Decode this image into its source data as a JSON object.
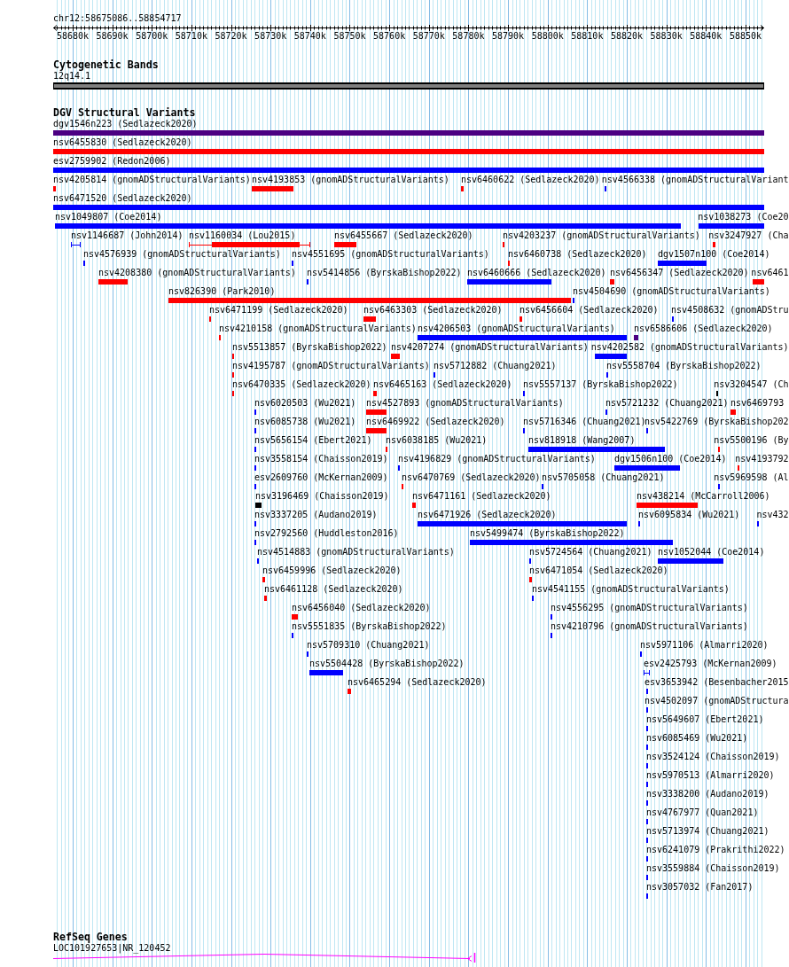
{
  "ruler": {
    "locus": "chr12:58675086..58854717",
    "ticks": [
      "58680k",
      "58690k",
      "58700k",
      "58710k",
      "58720k",
      "58730k",
      "58740k",
      "58750k",
      "58760k",
      "58770k",
      "58780k",
      "58790k",
      "58800k",
      "58810k",
      "58820k",
      "58830k",
      "58840k",
      "58850k"
    ]
  },
  "tracks": [
    {
      "kind": "bands",
      "title": "Cytogenetic Bands",
      "features": [
        {
          "label": "12q14.1"
        }
      ]
    },
    {
      "kind": "variants",
      "title": "DGV Structural Variants",
      "rows": [
        {
          "features": [
            {
              "label": "dgv1546n223 (Sedlazeck2020)",
              "color": "#4b0082",
              "kind": "bar"
            }
          ]
        },
        {
          "features": [
            {
              "label": "nsv6455830 (Sedlazeck2020)",
              "color": "#ff0000",
              "kind": "bar"
            }
          ]
        },
        {
          "features": [
            {
              "label": "esv2759902 (Redon2006)",
              "color": "#0000ff",
              "kind": "bar"
            }
          ]
        },
        {
          "features": [
            {
              "label": "nsv4205814 (gnomADStructuralVariants)",
              "color": "#ff0000",
              "kind": "bar"
            },
            {
              "label": "nsv4193853 (gnomADStructuralVariants)",
              "color": "#ff0000",
              "kind": "bar"
            },
            {
              "label": "nsv6460622 (Sedlazeck2020)",
              "color": "#ff0000",
              "kind": "bar"
            },
            {
              "label": "nsv4566338 (gnomADStructuralVariant",
              "color": "#0000ff",
              "kind": "bar"
            }
          ]
        },
        {
          "features": [
            {
              "label": "nsv6471520 (Sedlazeck2020)",
              "color": "#0000ff",
              "kind": "bar"
            }
          ]
        },
        {
          "features": [
            {
              "label": "nsv1049807 (Coe2014)",
              "color": "#0000ff",
              "kind": "bar"
            },
            {
              "label": "nsv1038273 (Coe20",
              "color": "#0000ff",
              "kind": "bar"
            }
          ]
        },
        {
          "features": [
            {
              "label": "nsv1146687 (John2014)",
              "color": "#0000ff",
              "kind": "whiskered"
            },
            {
              "label": "nsv1160034 (Lou2015)",
              "color": "#ff0000",
              "kind": "whiskered"
            },
            {
              "label": "nsv6455667 (Sedlazeck2020)",
              "color": "#ff0000",
              "kind": "bar"
            },
            {
              "label": "nsv4203237 (gnomADStructuralVariants)",
              "color": "#ff0000",
              "kind": "bar"
            },
            {
              "label": "nsv3247927 (Cha",
              "color": "#ff0000",
              "kind": "bar"
            }
          ]
        },
        {
          "features": [
            {
              "label": "nsv4576939 (gnomADStructuralVariants)",
              "color": "#0000ff",
              "kind": "bar"
            },
            {
              "label": "nsv4551695 (gnomADStructuralVariants)",
              "color": "#0000ff",
              "kind": "bar"
            },
            {
              "label": "nsv6460738 (Sedlazeck2020)",
              "color": "#ff0000",
              "kind": "bar"
            },
            {
              "label": "dgv1507n100 (Coe2014)",
              "color": "#0000ff",
              "kind": "bar"
            }
          ]
        },
        {
          "features": [
            {
              "label": "nsv4208380 (gnomADStructuralVariants)",
              "color": "#ff0000",
              "kind": "bar"
            },
            {
              "label": "nsv5414856 (ByrskaBishop2022)",
              "color": "#0000ff",
              "kind": "bar"
            },
            {
              "label": "nsv6460666 (Sedlazeck2020)",
              "color": "#0000ff",
              "kind": "bar"
            },
            {
              "label": "nsv6456347 (Sedlazeck2020)",
              "color": "#ff0000",
              "kind": "bar"
            },
            {
              "label": "nsv6461",
              "color": "#ff0000",
              "kind": "bar"
            }
          ]
        },
        {
          "features": [
            {
              "label": "nsv826390 (Park2010)",
              "color": "#ff0000",
              "kind": "bar"
            },
            {
              "label": "nsv4504690 (gnomADStructuralVariants)",
              "color": "#0000ff",
              "kind": "bar"
            }
          ]
        },
        {
          "features": [
            {
              "label": "nsv6471199 (Sedlazeck2020)",
              "color": "#ff0000",
              "kind": "bar"
            },
            {
              "label": "nsv6463303 (Sedlazeck2020)",
              "color": "#ff0000",
              "kind": "bar"
            },
            {
              "label": "nsv6456604 (Sedlazeck2020)",
              "color": "#ff0000",
              "kind": "bar"
            },
            {
              "label": "nsv4508632 (gnomADStru",
              "color": "#0000ff",
              "kind": "bar"
            }
          ]
        },
        {
          "features": [
            {
              "label": "nsv4210158 (gnomADStructuralVariants)",
              "color": "#ff0000",
              "kind": "bar"
            },
            {
              "label": "nsv4206503 (gnomADStructuralVariants)",
              "color": "#0000ff",
              "kind": "bar"
            },
            {
              "label": "nsv6586606 (Sedlazeck2020)",
              "color": "#4b0082",
              "kind": "bar"
            }
          ]
        },
        {
          "features": [
            {
              "label": "nsv5513857 (ByrskaBishop2022)",
              "color": "#ff0000",
              "kind": "bar"
            },
            {
              "label": "nsv4207274 (gnomADStructuralVariants)",
              "color": "#ff0000",
              "kind": "bar"
            },
            {
              "label": "nsv4202582 (gnomADStructuralVariants)",
              "color": "#0000ff",
              "kind": "bar"
            }
          ]
        },
        {
          "features": [
            {
              "label": "nsv4195787 (gnomADStructuralVariants)",
              "color": "#ff0000",
              "kind": "bar"
            },
            {
              "label": "nsv5712882 (Chuang2021)",
              "color": "#0000ff",
              "kind": "bar"
            },
            {
              "label": "nsv5558704 (ByrskaBishop2022)",
              "color": "#0000ff",
              "kind": "bar"
            }
          ]
        },
        {
          "features": [
            {
              "label": "nsv6470335 (Sedlazeck2020)",
              "color": "#ff0000",
              "kind": "bar"
            },
            {
              "label": "nsv6465163 (Sedlazeck2020)",
              "color": "#ff0000",
              "kind": "bar"
            },
            {
              "label": "nsv5557137 (ByrskaBishop2022)",
              "color": "#0000ff",
              "kind": "bar"
            },
            {
              "label": "nsv3204547 (Ch",
              "color": "#000000",
              "kind": "bar"
            }
          ]
        },
        {
          "features": [
            {
              "label": "nsv6020503 (Wu2021)",
              "color": "#0000ff",
              "kind": "bar"
            },
            {
              "label": "nsv4527893 (gnomADStructuralVariants)",
              "color": "#ff0000",
              "kind": "bar"
            },
            {
              "label": "nsv5721232 (Chuang2021)",
              "color": "#0000ff",
              "kind": "bar"
            },
            {
              "label": "nsv6469793",
              "color": "#ff0000",
              "kind": "bar"
            }
          ]
        },
        {
          "features": [
            {
              "label": "nsv6085738 (Wu2021)",
              "color": "#0000ff",
              "kind": "bar"
            },
            {
              "label": "nsv6469922 (Sedlazeck2020)",
              "color": "#ff0000",
              "kind": "bar"
            },
            {
              "label": "nsv5716346 (Chuang2021)",
              "color": "#0000ff",
              "kind": "bar"
            },
            {
              "label": "nsv5422769 (ByrskaBishop202",
              "color": "#0000ff",
              "kind": "bar"
            }
          ]
        },
        {
          "features": [
            {
              "label": "nsv5656154 (Ebert2021)",
              "color": "#0000ff",
              "kind": "bar"
            },
            {
              "label": "nsv6038185 (Wu2021)",
              "color": "#ff0000",
              "kind": "bar"
            },
            {
              "label": "nsv818918 (Wang2007)",
              "color": "#0000ff",
              "kind": "bar"
            },
            {
              "label": "nsv5500196 (By",
              "color": "#ff0000",
              "kind": "bar"
            }
          ]
        },
        {
          "features": [
            {
              "label": "nsv3558154 (Chaisson2019)",
              "color": "#0000ff",
              "kind": "bar"
            },
            {
              "label": "nsv4196829 (gnomADStructuralVariants)",
              "color": "#0000ff",
              "kind": "bar"
            },
            {
              "label": "dgv1506n100 (Coe2014)",
              "color": "#0000ff",
              "kind": "bar"
            },
            {
              "label": "nsv4193792",
              "color": "#ff0000",
              "kind": "bar"
            }
          ]
        },
        {
          "features": [
            {
              "label": "esv2609760 (McKernan2009)",
              "color": "#0000ff",
              "kind": "bar"
            },
            {
              "label": "nsv6470769 (Sedlazeck2020)",
              "color": "#ff0000",
              "kind": "bar"
            },
            {
              "label": "nsv5705058 (Chuang2021)",
              "color": "#0000ff",
              "kind": "bar"
            },
            {
              "label": "nsv5969598 (Al",
              "color": "#0000ff",
              "kind": "bar"
            }
          ]
        },
        {
          "features": [
            {
              "label": "nsv3196469 (Chaisson2019)",
              "color": "#000000",
              "kind": "bar"
            },
            {
              "label": "nsv6471161 (Sedlazeck2020)",
              "color": "#ff0000",
              "kind": "bar"
            },
            {
              "label": "nsv438214 (McCarroll2006)",
              "color": "#ff0000",
              "kind": "bar"
            }
          ]
        },
        {
          "features": [
            {
              "label": "nsv3337205 (Audano2019)",
              "color": "#0000ff",
              "kind": "bar"
            },
            {
              "label": "nsv6471926 (Sedlazeck2020)",
              "color": "#0000ff",
              "kind": "bar"
            },
            {
              "label": "nsv6095834 (Wu2021)",
              "color": "#0000ff",
              "kind": "bar"
            },
            {
              "label": "nsv432",
              "color": "#0000ff",
              "kind": "bar"
            }
          ]
        },
        {
          "features": [
            {
              "label": "nsv2792560 (Huddleston2016)",
              "color": "#0000ff",
              "kind": "bar"
            },
            {
              "label": "nsv5499474 (ByrskaBishop2022)",
              "color": "#0000ff",
              "kind": "bar"
            }
          ]
        },
        {
          "features": [
            {
              "label": "nsv4514883 (gnomADStructuralVariants)",
              "color": "#0000ff",
              "kind": "bar"
            },
            {
              "label": "nsv5724564 (Chuang2021)",
              "color": "#0000ff",
              "kind": "bar"
            },
            {
              "label": "nsv1052044 (Coe2014)",
              "color": "#0000ff",
              "kind": "bar"
            }
          ]
        },
        {
          "features": [
            {
              "label": "nsv6459996 (Sedlazeck2020)",
              "color": "#ff0000",
              "kind": "bar"
            },
            {
              "label": "nsv6471054 (Sedlazeck2020)",
              "color": "#ff0000",
              "kind": "bar"
            }
          ]
        },
        {
          "features": [
            {
              "label": "nsv6461128 (Sedlazeck2020)",
              "color": "#ff0000",
              "kind": "bar"
            },
            {
              "label": "nsv4541155 (gnomADStructuralVariants)",
              "color": "#0000ff",
              "kind": "bar"
            }
          ]
        },
        {
          "features": [
            {
              "label": "nsv6456040 (Sedlazeck2020)",
              "color": "#ff0000",
              "kind": "bar"
            },
            {
              "label": "nsv4556295 (gnomADStructuralVariants)",
              "color": "#0000ff",
              "kind": "bar"
            }
          ]
        },
        {
          "features": [
            {
              "label": "nsv5551835 (ByrskaBishop2022)",
              "color": "#0000ff",
              "kind": "bar"
            },
            {
              "label": "nsv4210796 (gnomADStructuralVariants)",
              "color": "#0000ff",
              "kind": "bar"
            }
          ]
        },
        {
          "features": [
            {
              "label": "nsv5709310 (Chuang2021)",
              "color": "#0000ff",
              "kind": "bar"
            },
            {
              "label": "nsv5971106 (Almarri2020)",
              "color": "#0000ff",
              "kind": "bar"
            }
          ]
        },
        {
          "features": [
            {
              "label": "nsv5504428 (ByrskaBishop2022)",
              "color": "#0000ff",
              "kind": "bar"
            },
            {
              "label": "esv2425793 (McKernan2009)",
              "color": "#0000ff",
              "kind": "whiskered"
            }
          ]
        },
        {
          "features": [
            {
              "label": "nsv6465294 (Sedlazeck2020)",
              "color": "#ff0000",
              "kind": "bar"
            },
            {
              "label": "esv3653942 (Besenbacher2015",
              "color": "#0000ff",
              "kind": "bar"
            }
          ]
        },
        {
          "features": [
            {
              "label": "nsv4502097 (gnomADStructura",
              "color": "#0000ff",
              "kind": "bar"
            }
          ]
        },
        {
          "features": [
            {
              "label": "nsv5649607 (Ebert2021)",
              "color": "#0000ff",
              "kind": "bar"
            }
          ]
        },
        {
          "features": [
            {
              "label": "nsv6085469 (Wu2021)",
              "color": "#0000ff",
              "kind": "bar"
            }
          ]
        },
        {
          "features": [
            {
              "label": "nsv3524124 (Chaisson2019)",
              "color": "#0000ff",
              "kind": "bar"
            }
          ]
        },
        {
          "features": [
            {
              "label": "nsv5970513 (Almarri2020)",
              "color": "#0000ff",
              "kind": "bar"
            }
          ]
        },
        {
          "features": [
            {
              "label": "nsv3338200 (Audano2019)",
              "color": "#0000ff",
              "kind": "bar"
            }
          ]
        },
        {
          "features": [
            {
              "label": "nsv4767977 (Quan2021)",
              "color": "#0000ff",
              "kind": "bar"
            }
          ]
        },
        {
          "features": [
            {
              "label": "nsv5713974 (Chuang2021)",
              "color": "#0000ff",
              "kind": "bar"
            }
          ]
        },
        {
          "features": [
            {
              "label": "nsv6241079 (Prakrithi2022)",
              "color": "#0000ff",
              "kind": "bar"
            }
          ]
        },
        {
          "features": [
            {
              "label": "nsv3559884 (Chaisson2019)",
              "color": "#0000ff",
              "kind": "bar"
            }
          ]
        },
        {
          "features": [
            {
              "label": "nsv3057032 (Fan2017)",
              "color": "#0000ff",
              "kind": "bar"
            }
          ]
        }
      ]
    },
    {
      "kind": "genes",
      "title": "RefSeq Genes",
      "features": [
        {
          "label": "LOC101927653|NR_120452"
        }
      ]
    }
  ]
}
